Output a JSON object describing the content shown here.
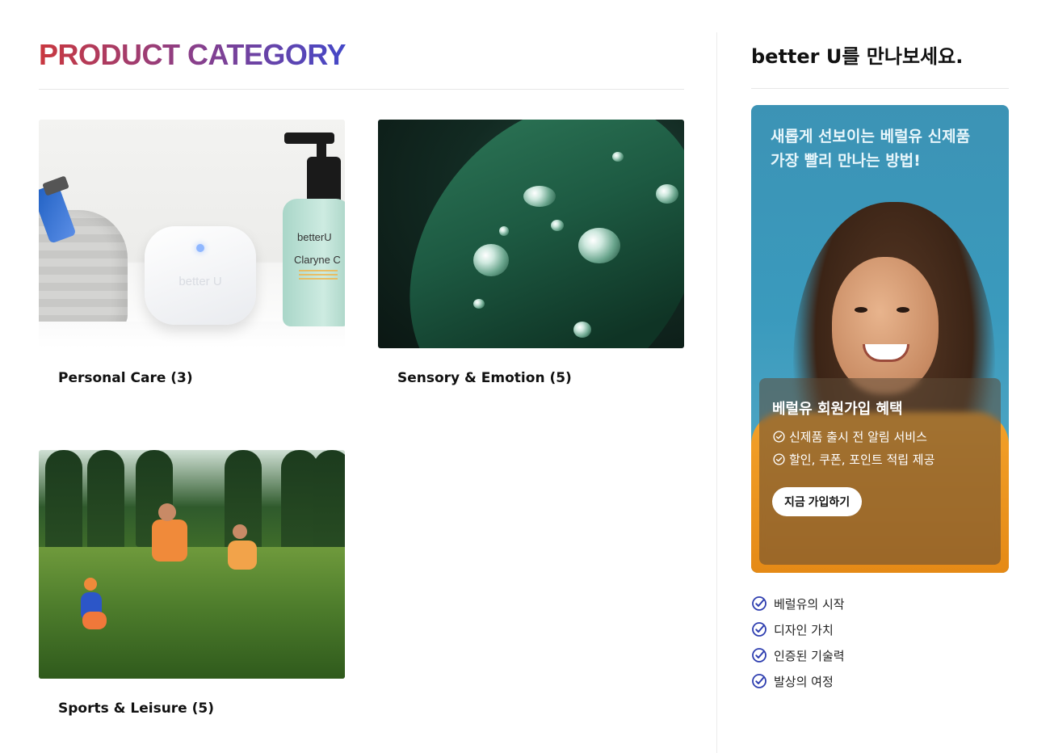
{
  "main": {
    "title": "PRODUCT CATEGORY",
    "categories": [
      {
        "label": "Personal Care (3)"
      },
      {
        "label": "Sensory & Emotion (5)"
      },
      {
        "label": "Sports & Leisure (5)"
      }
    ],
    "personal_care_image": {
      "device_text": "better U",
      "bottle_brand": "betterU",
      "bottle_product": "Claryne C"
    }
  },
  "sidebar": {
    "title": "better U를 만나보세요.",
    "banner": {
      "headline_line1": "새롭게 선보이는 베럴유 신제품",
      "headline_line2": "가장 빨리 만나는 방법!",
      "panel_title": "베럴유 회원가입 혜택",
      "benefits": [
        "신제품 출시 전 알림 서비스",
        "할인, 쿠폰, 포인트 적립 제공"
      ],
      "cta_label": "지금 가입하기"
    },
    "links": [
      "베럴유의 시작",
      "디자인 가치",
      "인증된 기술력",
      "발상의 여정"
    ]
  },
  "colors": {
    "title_gradient_start": "#c9383f",
    "title_gradient_end": "#4448c8",
    "check_icon": "#2f3fb0",
    "banner_bg": "#3c93b5"
  }
}
